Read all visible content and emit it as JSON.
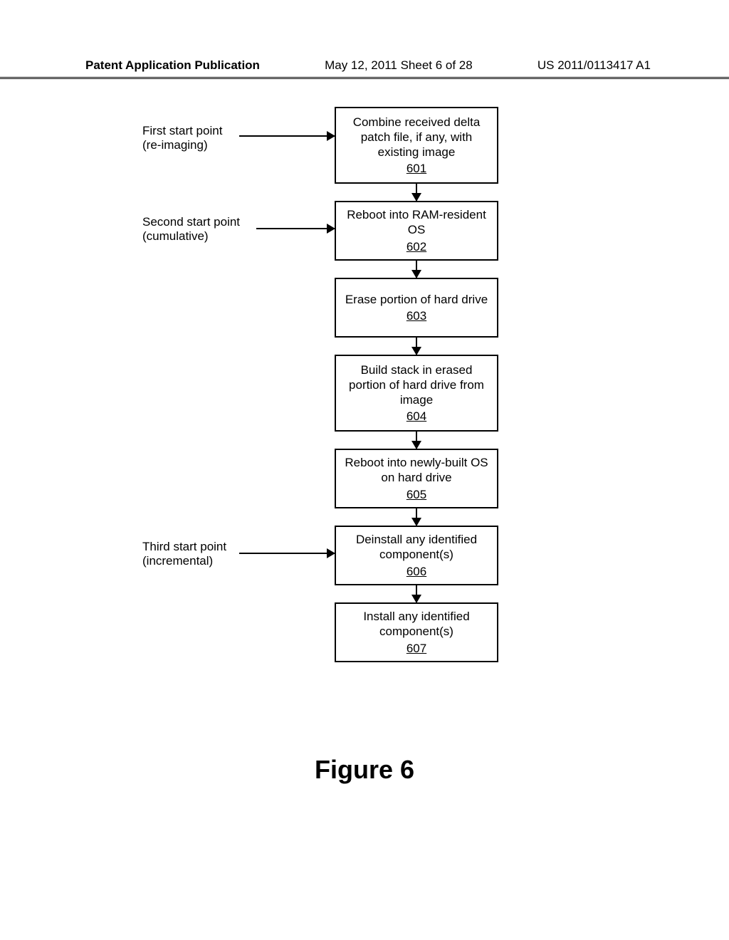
{
  "header": {
    "left": "Patent Application Publication",
    "mid": "May 12, 2011  Sheet 6 of 28",
    "right": "US 2011/0113417 A1"
  },
  "figure_title": "Figure 6",
  "labels": {
    "first": {
      "line1": "First start point",
      "line2": "(re-imaging)"
    },
    "second": {
      "line1": "Second start point",
      "line2": "(cumulative)"
    },
    "third": {
      "line1": "Third start point",
      "line2": "(incremental)"
    }
  },
  "boxes": {
    "b601": {
      "text": "Combine received delta patch file, if any, with existing image",
      "num": "601"
    },
    "b602": {
      "text": "Reboot into RAM-resident OS",
      "num": "602"
    },
    "b603": {
      "text": "Erase portion of hard drive",
      "num": "603"
    },
    "b604": {
      "text": "Build stack in erased portion of hard drive from image",
      "num": "604"
    },
    "b605": {
      "text": "Reboot into newly-built OS on hard drive",
      "num": "605"
    },
    "b606": {
      "text": "Deinstall any identified component(s)",
      "num": "606"
    },
    "b607": {
      "text": "Install any identified component(s)",
      "num": "607"
    }
  }
}
